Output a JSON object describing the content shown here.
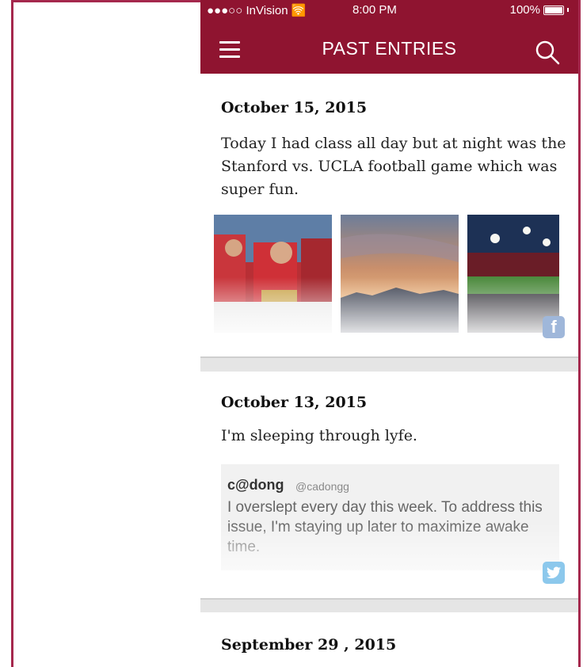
{
  "status_bar": {
    "carrier": "●●●○○ InVision",
    "wifi_icon": "wifi-icon",
    "time": "8:00 PM",
    "battery": "100%"
  },
  "header": {
    "title": "PAST ENTRIES",
    "menu_icon": "hamburger-menu-icon",
    "search_icon": "search-icon"
  },
  "entries": [
    {
      "date": "October 15, 2015",
      "text": "Today I had class all day but at night was the Stanford vs. UCLA football game which was super fun.",
      "photos": [
        "band-photo",
        "sunset-photo",
        "stadium-photo"
      ],
      "source_icon": "facebook-icon"
    },
    {
      "date": "October 13, 2015",
      "text": "I'm sleeping through lyfe.",
      "tweet": {
        "name": "c@dong",
        "handle": "@cadongg",
        "text": "I overslept every day this week. To address this issue, I'm staying up later to maximize awake time."
      },
      "source_icon": "twitter-icon"
    },
    {
      "date": "September 29 , 2015"
    }
  ],
  "colors": {
    "header_bg": "#8f1430",
    "frame": "#a5284d",
    "facebook": "#9fb7da",
    "twitter": "#8cc8ec"
  }
}
